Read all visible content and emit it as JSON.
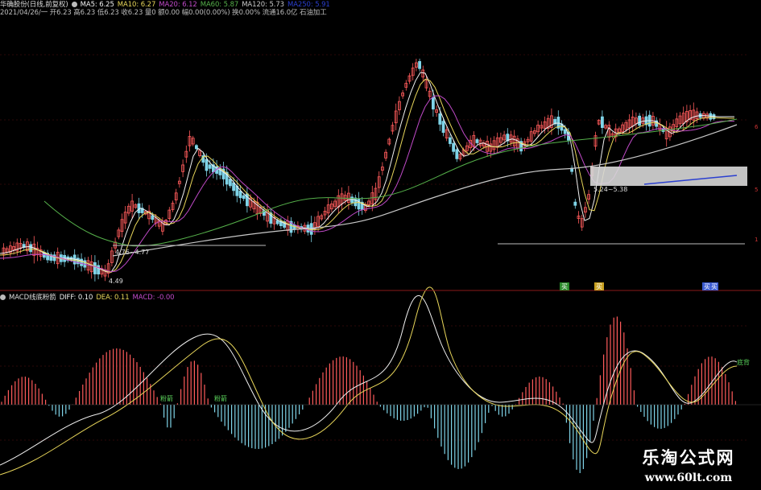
{
  "header": {
    "stock": "华确股份(日线,前复权)",
    "ma5": "MA5: 6.25",
    "ma10": "MA10: 6.27",
    "ma20": "MA20: 6.12",
    "ma60": "MA60: 5.87",
    "ma120": "MA120: 5.73",
    "macd_hidden": "MA250: 5.91",
    "line2": "2021/04/26/一 开6.23 高6.23 低6.23 收6.23 量0 额0.00 幅0.00(0.00%) 换0.00% 流通16.0亿 石油加工"
  },
  "macd_header": {
    "name": "MACD线底粉箭",
    "diff": "DIFF: 0.10",
    "dea": "DEA: 0.11",
    "macd": "MACD: -0.00"
  },
  "price_annotations": {
    "low_label": "4.49",
    "level_label_1": "4.76~4.77",
    "level_label_2": "5.24~5.38",
    "axis_right": [
      "6",
      "5",
      "1"
    ]
  },
  "signals": {
    "buy1": "买",
    "buy2": "买",
    "buy3": "买",
    "signal_left": "粉箭",
    "signal_mid": "粉箭",
    "signal_right": "底背",
    "signal_right2": "买"
  },
  "watermark": {
    "cn": "乐淘公式网",
    "url": "www.60lt.com"
  },
  "colors": {
    "up": "#ff5b5b",
    "down": "#7fd4e8",
    "ma_white": "#f0f0f0",
    "ma_yellow": "#e8d65a",
    "ma_purple": "#c04ac8",
    "ma_green": "#55b04a",
    "ma_gray": "#c8c8c8",
    "grid": "#5a1010"
  }
}
